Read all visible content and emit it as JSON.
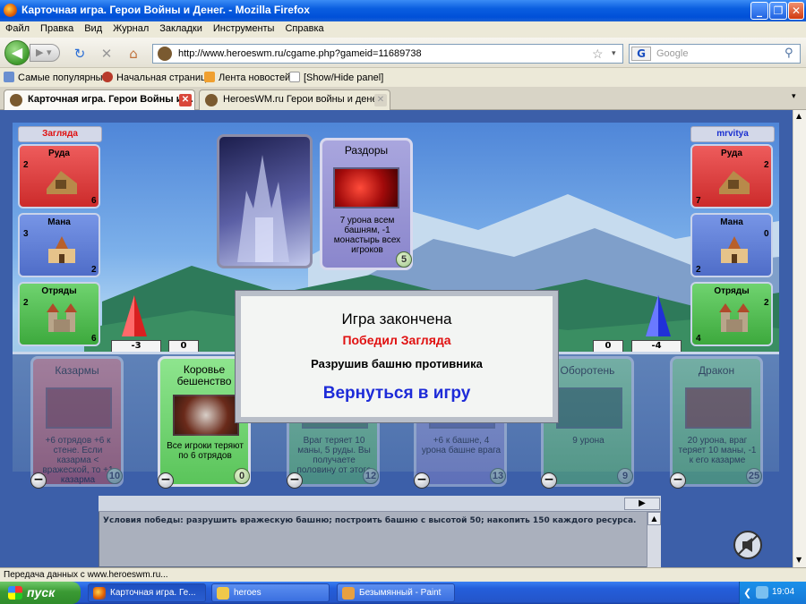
{
  "window": {
    "title": "Карточная игра. Герои Войны и Денег. - Mozilla Firefox"
  },
  "menu": [
    "Файл",
    "Правка",
    "Вид",
    "Журнал",
    "Закладки",
    "Инструменты",
    "Справка"
  ],
  "nav": {
    "url": "http://www.heroeswm.ru/cgame.php?gameid=11689738",
    "search_placeholder": "Google",
    "search_engine": "G"
  },
  "bookmarks": [
    "Самые популярные",
    "Начальная страница",
    "Лента новостей",
    "[Show/Hide panel]"
  ],
  "tabs": [
    {
      "label": "Карточная игра. Герои Войны и ..."
    },
    {
      "label": "HeroesWM.ru Герои войны и денег. ..."
    }
  ],
  "players": {
    "left": {
      "name": "Загляда",
      "tower": "-3",
      "wall": "0",
      "resources": [
        {
          "label": "Руда",
          "income": "2",
          "amount": "6"
        },
        {
          "label": "Мана",
          "income": "3",
          "amount": "2"
        },
        {
          "label": "Отряды",
          "income": "2",
          "amount": "6"
        }
      ]
    },
    "right": {
      "name": "mrvitya",
      "tower": "-4",
      "wall": "0",
      "resources": [
        {
          "label": "Руда",
          "income": "2",
          "amount": "7"
        },
        {
          "label": "Мана",
          "income": "0",
          "amount": "2"
        },
        {
          "label": "Отряды",
          "income": "2",
          "amount": "4"
        }
      ]
    }
  },
  "last_card": {
    "name": "Раздоры",
    "desc": "7 урона всем башням, -1 монастырь всех игроков",
    "cost": "5"
  },
  "hand": [
    {
      "name": "Казармы",
      "desc": "+6 отрядов +6 к стене. Если казарма < вражеской, то +1 казарма",
      "cost": "10"
    },
    {
      "name": "Коровье бешенство",
      "desc": "Все игроки теряют по 6 отрядов",
      "cost": "0"
    },
    {
      "name": "",
      "desc": "Враг теряет 10 маны, 5 руды. Вы получаете половину от этого",
      "cost": "12"
    },
    {
      "name": "",
      "desc": "+6 к башне, 4 урона башне врага",
      "cost": "13"
    },
    {
      "name": "Оборотень",
      "desc": "9 урона",
      "cost": "9"
    },
    {
      "name": "Дракон",
      "desc": "20 урона, враг теряет 10 маны, -1 к его казарме",
      "cost": "25"
    }
  ],
  "dialog": {
    "title": "Игра закончена",
    "winner": "Победил Загляда",
    "reason": "Разрушив башню противника",
    "return": "Вернуться в игру"
  },
  "log": {
    "text": "Условия победы: разрушить вражескую башню; построить башню с высотой 50; накопить 150 каждого ресурса."
  },
  "status": "Передача данных с www.heroeswm.ru...",
  "taskbar": {
    "start": "пуск",
    "items": [
      "Карточная игра. Ге...",
      "heroes",
      "Безымянный - Paint"
    ],
    "clock": "19:04"
  },
  "colors": {
    "winner": "#e01010",
    "return_link": "#1d2bd8",
    "left_name": "#e01010",
    "right_name": "#1a2fd0"
  }
}
